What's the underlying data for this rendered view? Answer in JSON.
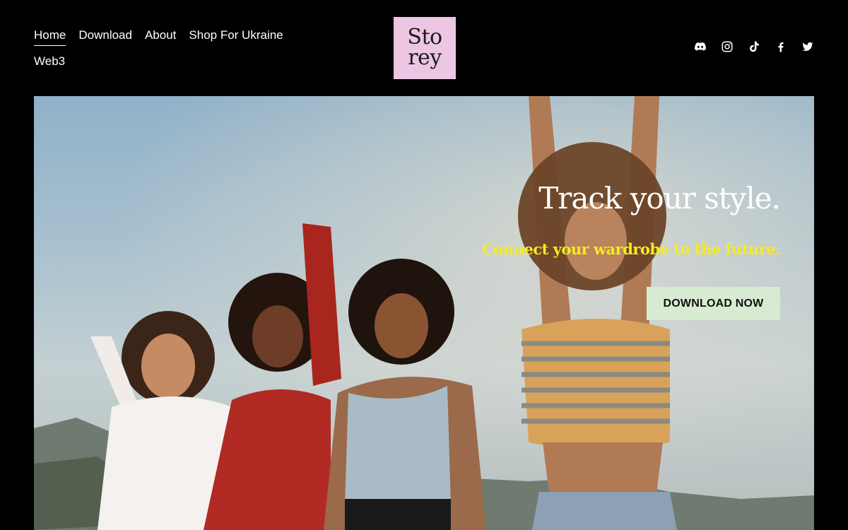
{
  "nav": {
    "items": [
      {
        "label": "Home",
        "active": true
      },
      {
        "label": "Download"
      },
      {
        "label": "About"
      },
      {
        "label": "Shop For Ukraine"
      },
      {
        "label": "Web3"
      }
    ]
  },
  "logo": {
    "line1": "Sto",
    "line2": "rey",
    "color": "#ecc6e3"
  },
  "social": [
    "discord-icon",
    "instagram-icon",
    "tiktok-icon",
    "facebook-icon",
    "twitter-icon"
  ],
  "hero": {
    "title": "Track your style.",
    "subtitle": "Connect your wardrobe to the future.",
    "cta_label": "DOWNLOAD NOW",
    "subtitle_color": "#f6ec1d",
    "cta_color": "#d7ebd2"
  }
}
